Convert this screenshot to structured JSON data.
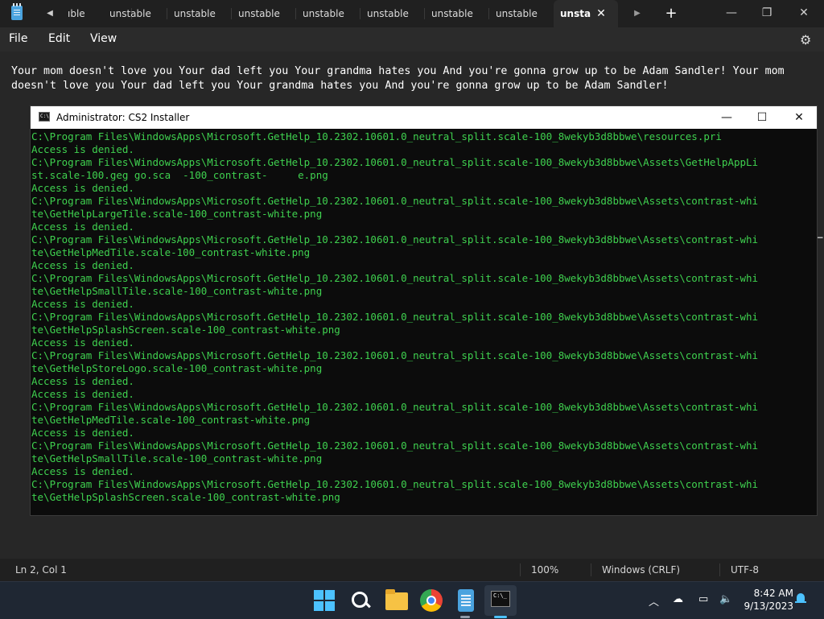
{
  "notepad": {
    "tabs": [
      {
        "label": "ıble"
      },
      {
        "label": "unstable"
      },
      {
        "label": "unstable"
      },
      {
        "label": "unstable"
      },
      {
        "label": "unstable"
      },
      {
        "label": "unstable"
      },
      {
        "label": "unstable"
      },
      {
        "label": "unstable"
      },
      {
        "label": "unsta"
      }
    ],
    "active_tab_index": 8,
    "tab_close_icon": "✕",
    "add_tab_icon": "+",
    "menu": {
      "file": "File",
      "edit": "Edit",
      "view": "View"
    },
    "settings_icon": "⚙",
    "editor_text": "Your mom doesn't love you Your dad left you Your grandma hates you And you're gonna grow up to be Adam Sandler! Your mom doesn't love you Your dad left you Your grandma hates you And you're gonna grow up to be Adam Sandler!",
    "status": {
      "position": "Ln 2, Col 1",
      "zoom": "100%",
      "line_ending": "Windows (CRLF)",
      "encoding": "UTF-8"
    }
  },
  "console": {
    "title": "Administrator:  CS2 Installer",
    "lines": [
      "C:\\Program Files\\WindowsApps\\Microsoft.GetHelp_10.2302.10601.0_neutral_split.scale-100_8wekyb3d8bbwe\\resources.pri",
      "Access is denied.",
      "C:\\Program Files\\WindowsApps\\Microsoft.GetHelp_10.2302.10601.0_neutral_split.scale-100_8wekyb3d8bbwe\\Assets\\GetHelpAppLi",
      "st.scale-100.geg go.sca  -100_contrast-     e.png",
      "Access is denied.",
      "C:\\Program Files\\WindowsApps\\Microsoft.GetHelp_10.2302.10601.0_neutral_split.scale-100_8wekyb3d8bbwe\\Assets\\contrast-whi",
      "te\\GetHelpLargeTile.scale-100_contrast-white.png",
      "Access is denied.",
      "C:\\Program Files\\WindowsApps\\Microsoft.GetHelp_10.2302.10601.0_neutral_split.scale-100_8wekyb3d8bbwe\\Assets\\contrast-whi",
      "te\\GetHelpMedTile.scale-100_contrast-white.png",
      "Access is denied.",
      "C:\\Program Files\\WindowsApps\\Microsoft.GetHelp_10.2302.10601.0_neutral_split.scale-100_8wekyb3d8bbwe\\Assets\\contrast-whi",
      "te\\GetHelpSmallTile.scale-100_contrast-white.png",
      "Access is denied.",
      "C:\\Program Files\\WindowsApps\\Microsoft.GetHelp_10.2302.10601.0_neutral_split.scale-100_8wekyb3d8bbwe\\Assets\\contrast-whi",
      "te\\GetHelpSplashScreen.scale-100_contrast-white.png",
      "Access is denied.",
      "C:\\Program Files\\WindowsApps\\Microsoft.GetHelp_10.2302.10601.0_neutral_split.scale-100_8wekyb3d8bbwe\\Assets\\contrast-whi",
      "te\\GetHelpStoreLogo.scale-100_contrast-white.png",
      "Access is denied.",
      "Access is denied.",
      "C:\\Program Files\\WindowsApps\\Microsoft.GetHelp_10.2302.10601.0_neutral_split.scale-100_8wekyb3d8bbwe\\Assets\\contrast-whi",
      "te\\GetHelpMedTile.scale-100_contrast-white.png",
      "Access is denied.",
      "C:\\Program Files\\WindowsApps\\Microsoft.GetHelp_10.2302.10601.0_neutral_split.scale-100_8wekyb3d8bbwe\\Assets\\contrast-whi",
      "te\\GetHelpSmallTile.scale-100_contrast-white.png",
      "Access is denied.",
      "C:\\Program Files\\WindowsApps\\Microsoft.GetHelp_10.2302.10601.0_neutral_split.scale-100_8wekyb3d8bbwe\\Assets\\contrast-whi",
      "te\\GetHelpSplashScreen.scale-100_contrast-white.png"
    ],
    "text_color": "#3fd14f"
  },
  "taskbar": {
    "apps": [
      "start-icon",
      "search-icon",
      "file-explorer-icon",
      "chrome-icon",
      "notepad-icon",
      "terminal-icon"
    ],
    "time": "8:42 AM",
    "date": "9/13/2023"
  }
}
